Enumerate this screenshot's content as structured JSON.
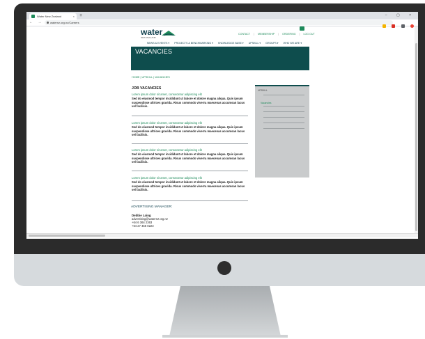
{
  "browser": {
    "tab_title": "Water New Zealand",
    "tab_close": "×",
    "new_tab": "+",
    "window_controls": "– ▢ ×",
    "nav_buttons": "← → C",
    "url": "waternz.org.nz/Careers"
  },
  "site": {
    "logo_word": "water",
    "logo_tag": "NEW ZEALAND",
    "util_nav": [
      "CONTACT",
      "MEMBERSHIP",
      "ORDERING",
      "LOG OUT"
    ],
    "util_sep": "|",
    "main_nav": [
      "NEWS & EVENTS ▾",
      "PROJECTS & BENCHMARKING ▾",
      "KNOWLEDGE BASE ▾",
      "UPSKILL ▾",
      "GROUPS ▾",
      "WHO WE ARE ▾"
    ]
  },
  "hero": {
    "title": "VACANCIES"
  },
  "breadcrumb": "HOME | UPSKILL | VACANCIES",
  "content": {
    "heading": "JOB VACANCIES",
    "jobs": [
      {
        "title": "Lorem ipsum dolor sit amet, consectetur adipiscing elit",
        "body": "Sed do eiusmod tempor incididunt ut labore et dolore magna aliqua. Quis ipsum suspendisse ultrices gravida. Risus commodo viverra maecenas accumsan lacus vel facilisis."
      },
      {
        "title": "Lorem ipsum dolor sit amet, consectetur adipiscing elit",
        "body": "Sed do eiusmod tempor incididunt ut labore et dolore magna aliqua. Quis ipsum suspendisse ultrices gravida. Risus commodo viverra maecenas accumsan lacus vel facilisis."
      },
      {
        "title": "Lorem ipsum dolor sit amet, consectetur adipiscing elit",
        "body": "Sed do eiusmod tempor incididunt ut labore et dolore magna aliqua. Quis ipsum suspendisse ultrices gravida. Risus commodo viverra maecenas accumsan lacus vel facilisis."
      },
      {
        "title": "Lorem ipsum dolor sit amet, consectetur adipiscing elit",
        "body": "Sed do eiusmod tempor incididunt ut labore et dolore magna aliqua. Quis ipsum suspendisse ultrices gravida. Risus commodo viverra maecenas accumsan lacus vel facilisis."
      }
    ]
  },
  "sidebar": {
    "label": "UPSKILL",
    "item": "Vacancies"
  },
  "advertising": {
    "heading": "ADVERTISING MANAGER:",
    "name": "Debbie Laing",
    "email": "advertising@waternz.org.nz",
    "phone1": "+64 6 364 2363",
    "phone2": "+64 27 455 0223"
  },
  "colors": {
    "brand_teal": "#0e4d4d",
    "link_green": "#1d8a5a"
  }
}
